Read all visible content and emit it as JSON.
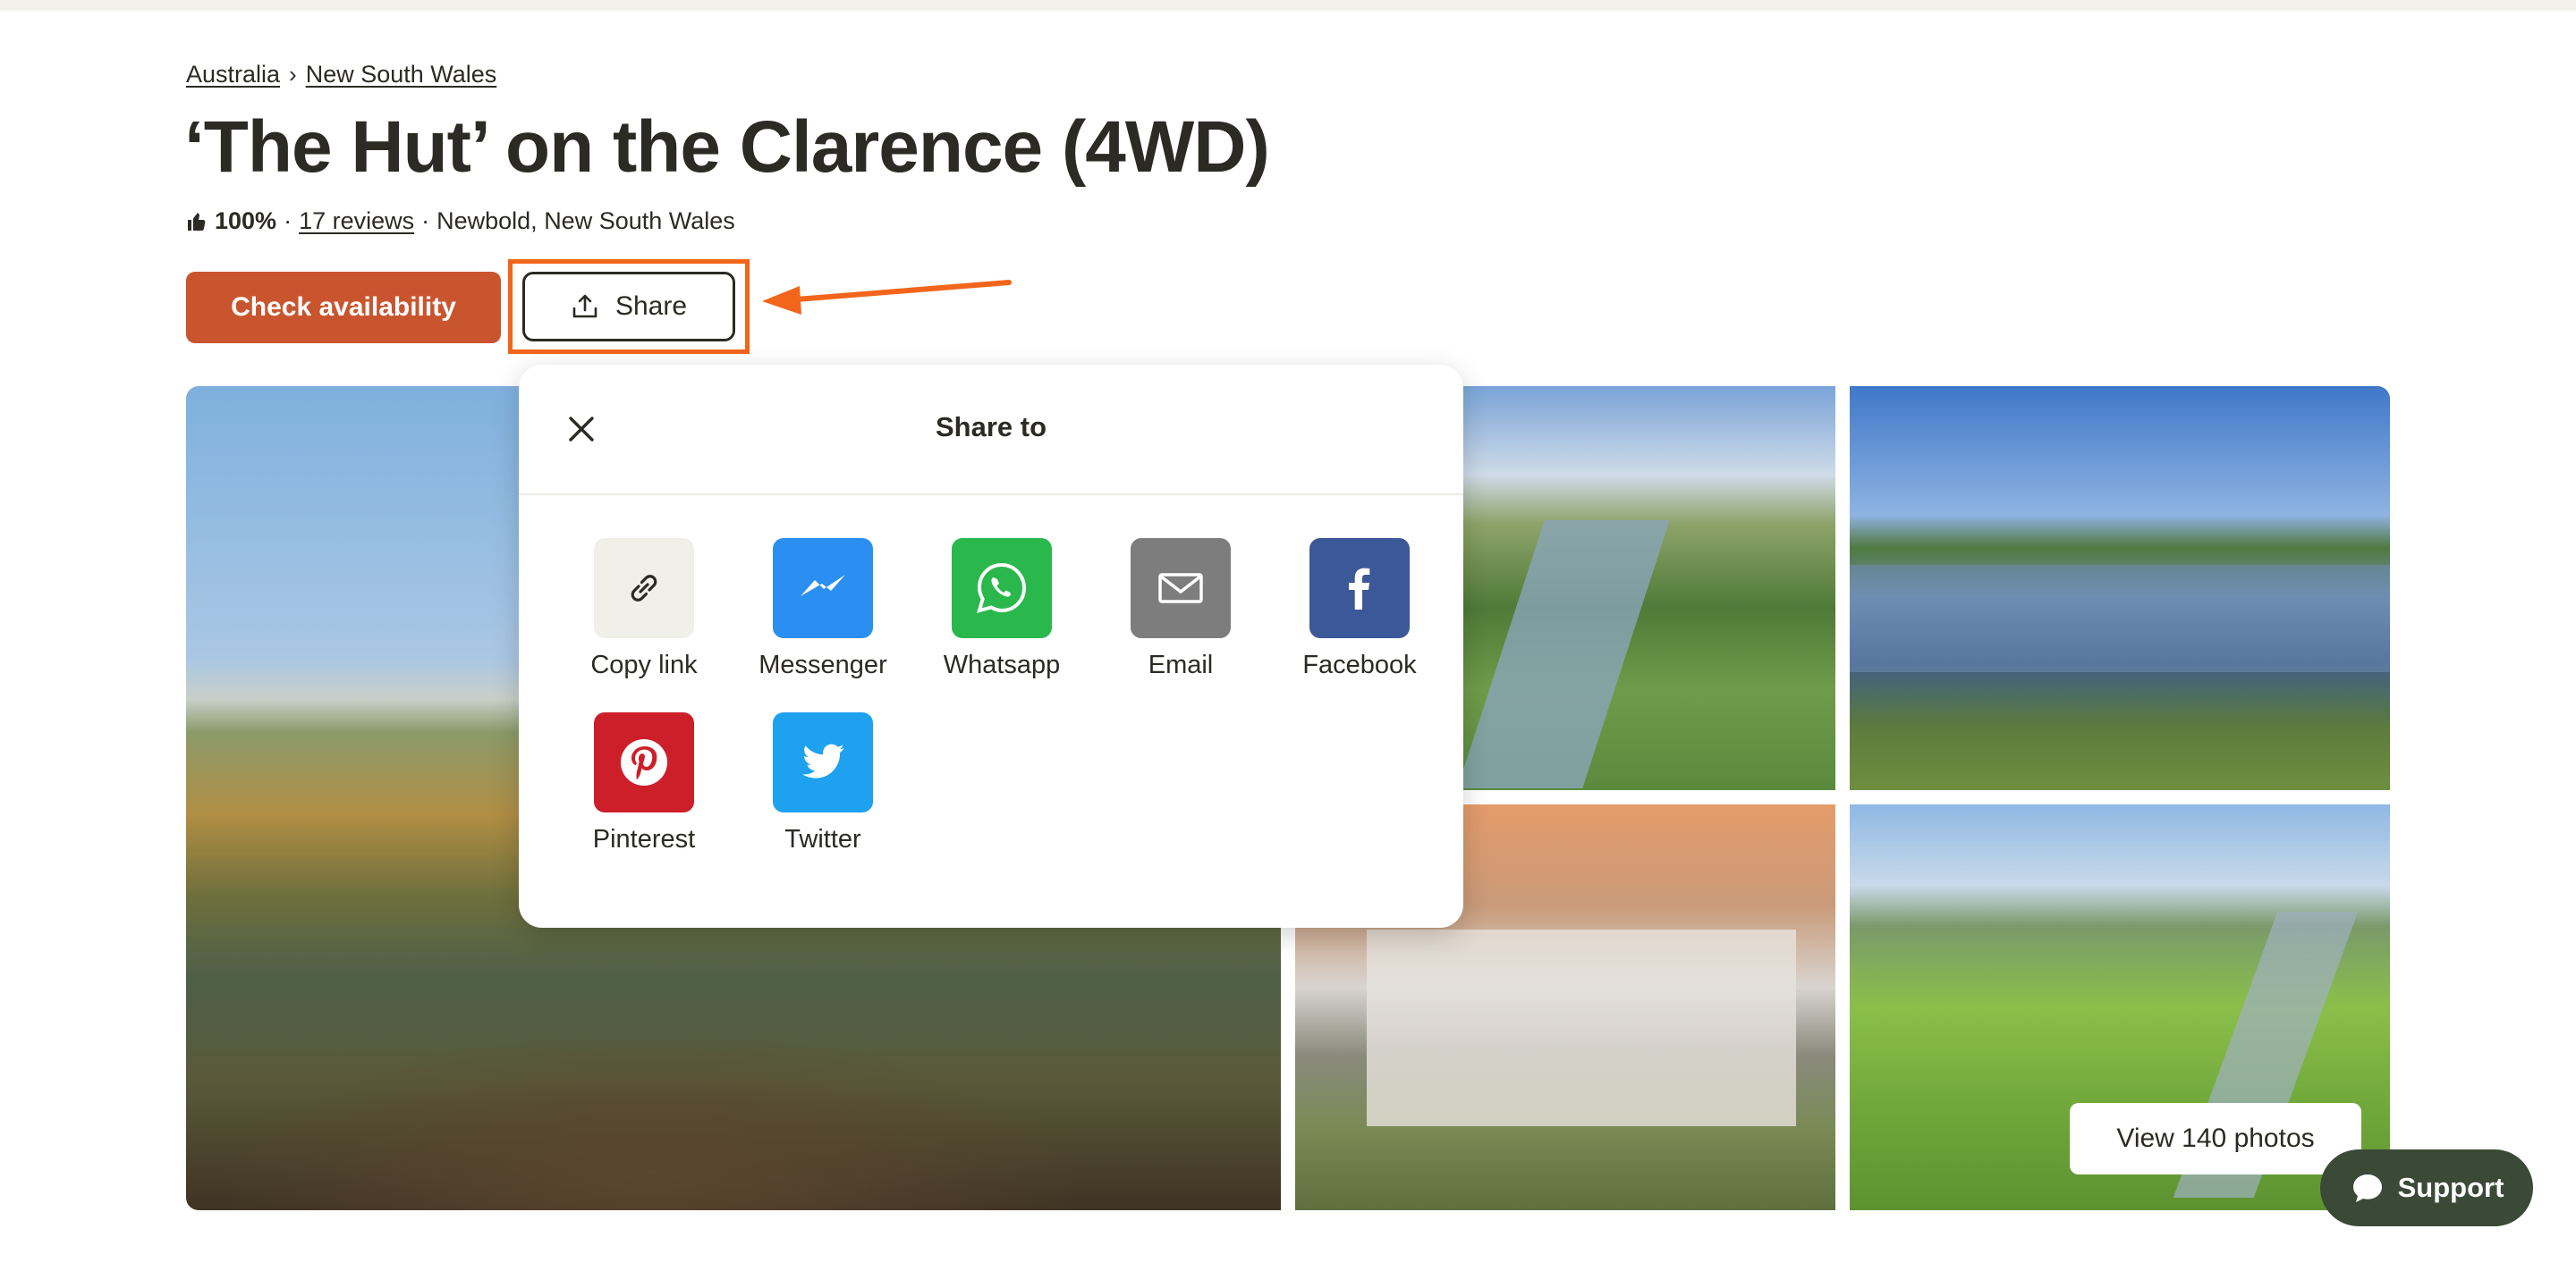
{
  "breadcrumb": {
    "items": [
      "Australia",
      "New South Wales"
    ]
  },
  "listing": {
    "title": "‘The Hut’ on the Clarence (4WD)",
    "rating": "100%",
    "dot1": "·",
    "reviews": "17 reviews",
    "dot2": "·",
    "location": "Newbold, New South Wales"
  },
  "actions": {
    "check": "Check availability",
    "share": "Share"
  },
  "share_modal": {
    "title": "Share to",
    "options": [
      {
        "label": "Copy link",
        "icon": "link-icon",
        "color": "#f1efea"
      },
      {
        "label": "Messenger",
        "icon": "messenger-icon",
        "color": "#2a8ff0"
      },
      {
        "label": "Whatsapp",
        "icon": "whatsapp-icon",
        "color": "#2ab84d"
      },
      {
        "label": "Email",
        "icon": "email-icon",
        "color": "#7d7d7d"
      },
      {
        "label": "Facebook",
        "icon": "facebook-icon",
        "color": "#3b5898"
      },
      {
        "label": "Pinterest",
        "icon": "pinterest-icon",
        "color": "#cd1f2a"
      },
      {
        "label": "Twitter",
        "icon": "twitter-icon",
        "color": "#1ea1ee"
      }
    ]
  },
  "photos": {
    "view_all": "View 140 photos"
  },
  "support": {
    "label": "Support"
  },
  "colors": {
    "primary": "#c9552f",
    "highlight": "#f2651b",
    "support_bg": "#3a4a37",
    "text": "#2b2a25"
  }
}
